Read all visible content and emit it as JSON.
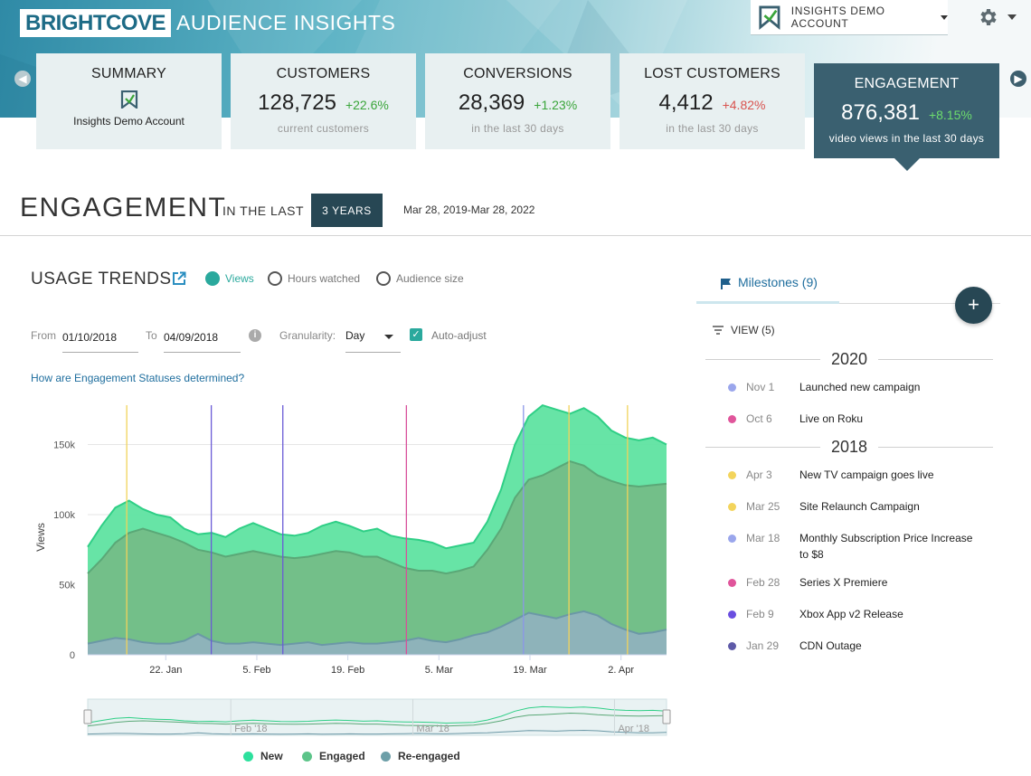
{
  "header": {
    "brand": "BRIGHTCOVE",
    "product": "AUDIENCE INSIGHTS",
    "account_label": "INSIGHTS DEMO ACCOUNT"
  },
  "cards": {
    "summary": {
      "title": "SUMMARY",
      "name": "Insights Demo Account"
    },
    "customers": {
      "title": "CUSTOMERS",
      "value": "128,725",
      "delta": "+22.6%",
      "sub": "current customers"
    },
    "conversions": {
      "title": "CONVERSIONS",
      "value": "28,369",
      "delta": "+1.23%",
      "sub": "in the last 30 days"
    },
    "lost": {
      "title": "LOST CUSTOMERS",
      "value": "4,412",
      "delta": "+4.82%",
      "sub": "in the last 30 days"
    },
    "engagement": {
      "title": "ENGAGEMENT",
      "value": "876,381",
      "delta": "+8.15%",
      "sub": "video views in the last 30 days"
    }
  },
  "engagement": {
    "title": "ENGAGEMENT",
    "in_the_last": "IN THE LAST",
    "range_button": "3 YEARS",
    "date_range": "Mar 28, 2019-Mar 28, 2022"
  },
  "usage": {
    "title": "USAGE TRENDS",
    "radios": [
      "Views",
      "Hours watched",
      "Audience size"
    ],
    "from_label": "From",
    "from_value": "01/10/2018",
    "to_label": "To",
    "to_value": "04/09/2018",
    "granularity_label": "Granularity:",
    "granularity_value": "Day",
    "auto_adjust": "Auto-adjust",
    "help_link": "How are Engagement Statuses determined?"
  },
  "chart_data": {
    "type": "area",
    "ylabel": "Views",
    "xlabel": "",
    "ylim": [
      0,
      180000
    ],
    "y_ticks": [
      "0",
      "50k",
      "100k",
      "150k"
    ],
    "x_ticks": [
      "22. Jan",
      "5. Feb",
      "19. Feb",
      "5. Mar",
      "19. Mar",
      "2. Apr"
    ],
    "navigator_ticks": [
      "Feb '18",
      "Mar '18",
      "Apr '18"
    ],
    "x_start": "2018-01-10",
    "x_end": "2018-04-09",
    "series": [
      {
        "name": "New",
        "color": "#5fe3a1",
        "values": [
          77000,
          92000,
          105000,
          110000,
          104000,
          100000,
          98000,
          90000,
          86000,
          87000,
          84000,
          90000,
          94000,
          90000,
          86000,
          85000,
          87000,
          92000,
          95000,
          92000,
          88000,
          90000,
          85000,
          83000,
          82000,
          80000,
          76000,
          78000,
          80000,
          95000,
          118000,
          150000,
          170000,
          178000,
          175000,
          172000,
          176000,
          170000,
          160000,
          155000,
          153000,
          155000,
          150000
        ]
      },
      {
        "name": "Engaged",
        "color": "#5dbb7e",
        "values": [
          58000,
          68000,
          80000,
          87000,
          90000,
          87000,
          84000,
          80000,
          75000,
          73000,
          70000,
          72000,
          74000,
          72000,
          70000,
          69000,
          70000,
          72000,
          74000,
          73000,
          70000,
          70000,
          66000,
          62000,
          60000,
          60000,
          58000,
          60000,
          63000,
          75000,
          90000,
          112000,
          125000,
          128000,
          133000,
          138000,
          135000,
          128000,
          124000,
          121000,
          120000,
          121000,
          122000
        ]
      },
      {
        "name": "Re-engaged",
        "color": "#6d9fa8",
        "values": [
          8000,
          10000,
          12000,
          11000,
          9000,
          8000,
          8000,
          10000,
          15000,
          10000,
          8000,
          8000,
          9000,
          8000,
          7000,
          8000,
          9000,
          7000,
          8000,
          9000,
          8000,
          8000,
          9000,
          10000,
          12000,
          10000,
          9000,
          11000,
          14000,
          16000,
          20000,
          25000,
          30000,
          28000,
          26000,
          29000,
          31000,
          28000,
          22000,
          18000,
          15000,
          16000,
          18000
        ]
      }
    ],
    "milestone_lines": [
      {
        "date": "Jan 16",
        "color": "#f2d35b"
      },
      {
        "date": "Jan 29",
        "color": "#6a5bd6"
      },
      {
        "date": "Feb 9",
        "color": "#6a5bd6"
      },
      {
        "date": "Feb 28",
        "color": "#d8509a"
      },
      {
        "date": "Mar 18",
        "color": "#8c96e8"
      },
      {
        "date": "Mar 25",
        "color": "#f2d35b"
      },
      {
        "date": "Apr 3",
        "color": "#f2d35b"
      }
    ],
    "legend": [
      "New",
      "Engaged",
      "Re-engaged"
    ],
    "legend_colors": [
      "#2de09d",
      "#5cc489",
      "#6d9fa8"
    ]
  },
  "milestones": {
    "tab_label": "Milestones (9)",
    "view_filter": "VIEW (5)",
    "groups": [
      {
        "year": "2020",
        "items": [
          {
            "date": "Nov 1",
            "text": "Launched new campaign",
            "color": "#9aa6ec"
          },
          {
            "date": "Oct 6",
            "text": "Live on Roku",
            "color": "#e0559b"
          }
        ]
      },
      {
        "year": "2018",
        "items": [
          {
            "date": "Apr 3",
            "text": "New TV campaign goes live",
            "color": "#f3d45c"
          },
          {
            "date": "Mar 25",
            "text": "Site Relaunch Campaign",
            "color": "#f3d45c"
          },
          {
            "date": "Mar 18",
            "text": "Monthly Subscription Price Increase to $8",
            "color": "#9aa6ec"
          },
          {
            "date": "Feb 28",
            "text": "Series X Premiere",
            "color": "#e0559b"
          },
          {
            "date": "Feb 9",
            "text": "Xbox App v2 Release",
            "color": "#6a4ee0"
          },
          {
            "date": "Jan 29",
            "text": "CDN Outage",
            "color": "#5e5aa8"
          }
        ]
      }
    ]
  }
}
